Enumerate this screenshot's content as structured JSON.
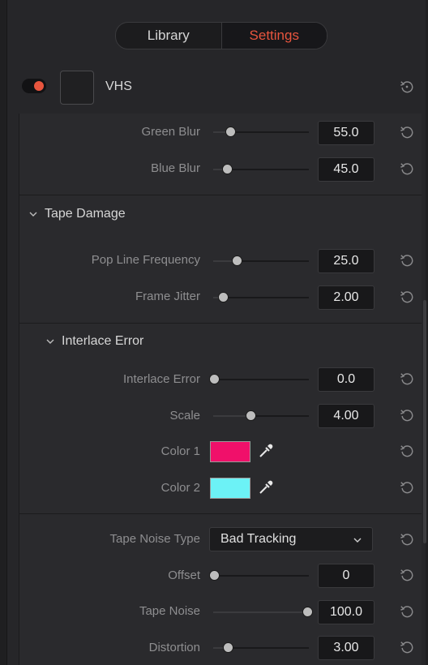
{
  "tabs": {
    "library": "Library",
    "settings": "Settings",
    "active": "Settings"
  },
  "header": {
    "title": "VHS",
    "enabled": true
  },
  "colors": {
    "accent": "#e8553e",
    "color1": "#f0106a",
    "color2": "#6cf2f6"
  },
  "rows": {
    "green_blur": {
      "label": "Green Blur",
      "value": "55.0",
      "fraction": 0.19
    },
    "blue_blur": {
      "label": "Blue Blur",
      "value": "45.0",
      "fraction": 0.16
    },
    "pop_line": {
      "label": "Pop Line Frequency",
      "value": "25.0",
      "fraction": 0.25
    },
    "frame_jitter": {
      "label": "Frame Jitter",
      "value": "2.00",
      "fraction": 0.1
    },
    "interlace_error": {
      "label": "Interlace Error",
      "value": "0.0",
      "fraction": 0.0
    },
    "scale": {
      "label": "Scale",
      "value": "4.00",
      "fraction": 0.4
    },
    "color1": {
      "label": "Color 1"
    },
    "color2": {
      "label": "Color 2"
    },
    "tape_noise_type": {
      "label": "Tape Noise Type",
      "value": "Bad Tracking"
    },
    "offset": {
      "label": "Offset",
      "value": "0",
      "fraction": 0.0
    },
    "tape_noise": {
      "label": "Tape Noise",
      "value": "100.0",
      "fraction": 1.0
    },
    "distortion": {
      "label": "Distortion",
      "value": "3.00",
      "fraction": 0.15
    }
  },
  "groups": {
    "tape_damage": "Tape Damage",
    "interlace_error": "Interlace Error"
  },
  "icons": {
    "reset": "reset-icon",
    "chevron": "chevron-down-icon",
    "eyedropper": "eyedropper-icon"
  }
}
